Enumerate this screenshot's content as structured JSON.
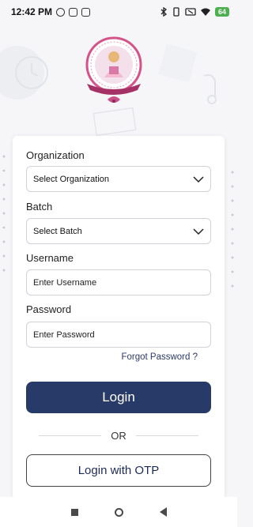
{
  "status_bar": {
    "time": "12:42 PM",
    "battery": "64"
  },
  "login_form": {
    "organization": {
      "label": "Organization",
      "value": "Select Organization"
    },
    "batch": {
      "label": "Batch",
      "value": "Select Batch"
    },
    "username": {
      "label": "Username",
      "placeholder": "Enter Username"
    },
    "password": {
      "label": "Password",
      "placeholder": "Enter Password"
    },
    "forgot_password": "Forgot Password ?",
    "login_button": "Login",
    "or_text": "OR",
    "otp_button": "Login with OTP"
  },
  "colors": {
    "primary": "#283a68",
    "link": "#2b3a67",
    "logo_ring": "#d4548a"
  },
  "icons": [
    "chevron-down-icon",
    "nav-recents-icon",
    "nav-home-icon",
    "nav-back-icon"
  ]
}
